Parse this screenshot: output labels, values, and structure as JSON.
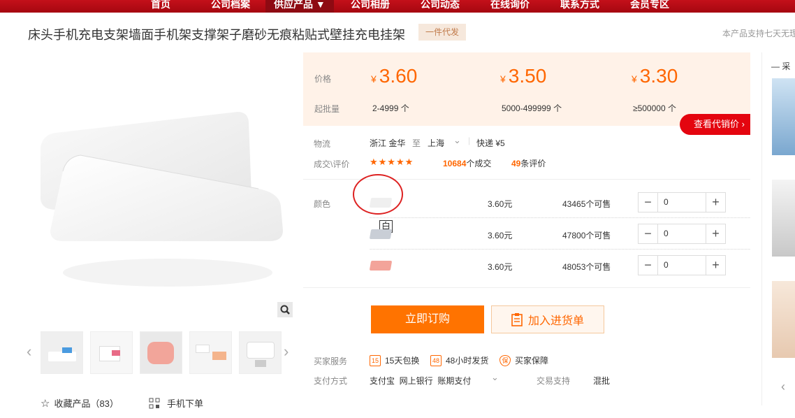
{
  "nav": {
    "items": [
      "首页",
      "公司档案",
      "供应产品 ▼",
      "公司相册",
      "公司动态",
      "在线询价",
      "联系方式",
      "会员专区"
    ],
    "active_index": 2
  },
  "product": {
    "title": "床头手机充电支架墙面手机架支撑架子磨砂无痕粘贴式壁挂充电挂架",
    "badge": "一件代发",
    "right_note": "本产品支持七天无理"
  },
  "price": {
    "price_label": "价格",
    "batch_label": "起批量",
    "currency": "¥",
    "tiers": [
      {
        "price": "3.60",
        "qty": "2-4999 个"
      },
      {
        "price": "3.50",
        "qty": "5000-499999 个"
      },
      {
        "price": "3.30",
        "qty": "≥500000 个"
      }
    ],
    "agent_button": "查看代销价 ›"
  },
  "logistics": {
    "label": "物流",
    "from": "浙江 金华",
    "to_word": "至",
    "to": "上海",
    "dropdown_icon": "chevron-down-icon",
    "express": "快递 ¥5"
  },
  "deals": {
    "label": "成交\\评价",
    "stars": "★★★★★",
    "rating": 4.5,
    "count": "10684",
    "count_suffix": "个成交",
    "reviews": "49",
    "reviews_suffix": "条评价"
  },
  "colors": {
    "label": "颜色",
    "tooltip": "白",
    "variants": [
      {
        "swatch": "#efefef",
        "price": "3.60元",
        "stock": "43465个可售",
        "qty": "0"
      },
      {
        "swatch": "#c9ced6",
        "price": "3.60元",
        "stock": "47800个可售",
        "qty": "0"
      },
      {
        "swatch": "#f3a49a",
        "price": "3.60元",
        "stock": "48053个可售",
        "qty": "0"
      }
    ]
  },
  "actions": {
    "buy": "立即订购",
    "cart": "加入进货单"
  },
  "services": {
    "label": "买家服务",
    "items": [
      {
        "icon": "15",
        "text": "15天包换"
      },
      {
        "icon": "48",
        "text": "48小时发货"
      },
      {
        "icon": "保",
        "text": "买家保障"
      }
    ]
  },
  "payment": {
    "label": "支付方式",
    "methods": "支付宝  网上银行  账期支付",
    "trade_label": "交易支持",
    "trade_value": "混批"
  },
  "gallery": {
    "favorite": "收藏产品（83）",
    "mobile": "手机下单"
  },
  "right_column": {
    "heading": "— 采"
  },
  "theme": {
    "brand_red": "#c4101a",
    "accent_orange": "#ff7300"
  }
}
